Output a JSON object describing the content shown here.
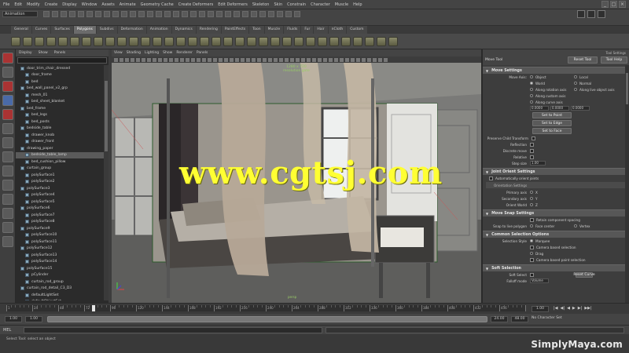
{
  "menubar": {
    "items": [
      "File",
      "Edit",
      "Modify",
      "Create",
      "Display",
      "Window",
      "Assets",
      "Animate",
      "Geometry Cache",
      "Create Deformers",
      "Edit Deformers",
      "Skeleton",
      "Skin",
      "Constrain",
      "Character",
      "Muscle",
      "Help"
    ]
  },
  "statusline": {
    "mode": "Animation"
  },
  "shelf": {
    "tabs": [
      "General",
      "Curves",
      "Surfaces",
      "Polygons",
      "Subdivs",
      "Deformation",
      "Animation",
      "Dynamics",
      "Rendering",
      "PaintEffects",
      "Toon",
      "Muscle",
      "Fluids",
      "Fur",
      "Hair",
      "nCloth",
      "Custom"
    ],
    "active_tab": "Polygons"
  },
  "outliner": {
    "menu": [
      "Display",
      "Show",
      "Panels"
    ],
    "items": [
      {
        "label": "door_trim_chair_dressed",
        "selected": false
      },
      {
        "label": "door_frame",
        "selected": false
      },
      {
        "label": "bed",
        "selected": false
      },
      {
        "label": "bed_wall_panel_v2_grp",
        "selected": false
      },
      {
        "label": "mesh_01",
        "selected": false
      },
      {
        "label": "bed_sheet_blanket",
        "selected": false
      },
      {
        "label": "bed_frame",
        "selected": false
      },
      {
        "label": "bed_legs",
        "selected": false
      },
      {
        "label": "bed_posts",
        "selected": false
      },
      {
        "label": "bedside_table",
        "selected": false
      },
      {
        "label": "drawer_knob",
        "selected": false
      },
      {
        "label": "drawer_front",
        "selected": false
      },
      {
        "label": "drawing_paper",
        "selected": false
      },
      {
        "label": "bedside_table_lamp",
        "selected": true
      },
      {
        "label": "bed_cushion_pillow",
        "selected": false
      },
      {
        "label": "curtain_group",
        "selected": false
      },
      {
        "label": "polySurface1",
        "selected": false
      },
      {
        "label": "polySurface2",
        "selected": false
      },
      {
        "label": "polySurface3",
        "selected": false
      },
      {
        "label": "polySurface4",
        "selected": false
      },
      {
        "label": "polySurface5",
        "selected": false
      },
      {
        "label": "polySurface6",
        "selected": false
      },
      {
        "label": "polySurface7",
        "selected": false
      },
      {
        "label": "polySurface8",
        "selected": false
      },
      {
        "label": "polySurface9",
        "selected": false
      },
      {
        "label": "polySurface10",
        "selected": false
      },
      {
        "label": "polySurface11",
        "selected": false
      },
      {
        "label": "polySurface12",
        "selected": false
      },
      {
        "label": "polySurface13",
        "selected": false
      },
      {
        "label": "polySurface14",
        "selected": false
      },
      {
        "label": "polySurface15",
        "selected": false
      },
      {
        "label": "pCylinder",
        "selected": false
      },
      {
        "label": "curtain_rod_group",
        "selected": false
      },
      {
        "label": "curtain_rod_detail_C3_D3",
        "selected": false
      },
      {
        "label": "defaultLightSet",
        "selected": false
      },
      {
        "label": "defaultObjectSet",
        "selected": false
      }
    ]
  },
  "viewport": {
    "menu": [
      "View",
      "Shading",
      "Lighting",
      "Show",
      "Renderer",
      "Panels"
    ],
    "stats_line1": "1280 x 720",
    "stats_line2": "resolution gate",
    "gate_label": "persp"
  },
  "watermark": {
    "text": "www.cgtsj.com"
  },
  "attr": {
    "caption": "Tool Settings",
    "title": "Move Tool",
    "reset_label": "Reset Tool",
    "help_label": "Tool Help",
    "move_settings": {
      "header": "Move Settings",
      "move_axis_label": "Move Axis:",
      "options": [
        {
          "label": "Object",
          "on": false
        },
        {
          "label": "Local",
          "on": false
        },
        {
          "label": "World",
          "on": true
        },
        {
          "label": "Normal",
          "on": false
        },
        {
          "label": "Along rotation axis",
          "on": false
        },
        {
          "label": "Along live object axis",
          "on": false
        },
        {
          "label": "Along custom axis",
          "on": false
        },
        {
          "label": "Along curve axis",
          "on": false
        }
      ],
      "xyz_values": [
        "0.0000",
        "0.0000",
        "0.0000"
      ],
      "set_to_point": "Set to Point",
      "set_to_edge": "Set to Edge",
      "set_to_face": "Set to Face",
      "preserve_uvs": "Preserve Child Transform",
      "reflection": "Reflection",
      "discrete_move": "Discrete move",
      "relative": "Relative",
      "step_size_label": "Step size",
      "step_size_value": "1.00"
    },
    "joint_orient": {
      "header": "Joint Orient Settings",
      "automatically_label": "Automatically orient joints",
      "sub": "Orientation Settings",
      "primary_axis": "Primary axis",
      "secondary_axis": "Secondary axis",
      "world_orient": "Orient World",
      "axis_x": "X",
      "axis_y": "Y",
      "axis_z": "Z"
    },
    "move_snap": {
      "header": "Move Snap Settings",
      "retain_label": "Retain component spacing",
      "snap_to_poly": "Snap to live polygon",
      "face_center": "Face center",
      "vertex": "Vertex"
    },
    "common_selection": {
      "header": "Common Selection Options",
      "selection_style": "Selection Style",
      "marquee": "Marquee",
      "camera_based": "Camera based selection",
      "drag": "Drag",
      "camera_based_paint": "Camera based paint selection"
    },
    "soft_selection": {
      "header": "Soft Selection",
      "soft_select": "Soft Select",
      "falloff_mode": "Falloff mode",
      "falloff_value": "Volume",
      "reset_curve": "Reset Curve"
    }
  },
  "timeslider": {
    "tick_labels": [
      "1",
      "24",
      "48",
      "72",
      "96",
      "120",
      "144",
      "168",
      "192",
      "216",
      "240",
      "264",
      "288",
      "312",
      "336",
      "360",
      "384",
      "408",
      "432",
      "456"
    ],
    "current_frame": "1.00",
    "play_controls": [
      "|◀",
      "◀|",
      "◀",
      "▶",
      "▶|",
      "▶▶|"
    ]
  },
  "range": {
    "start": "1.00",
    "start2": "1.00",
    "end": "24.00",
    "end2": "48.00",
    "char_set": "No Character Set"
  },
  "cmdline": {
    "label": "MEL"
  },
  "helpline": {
    "text": "Select Tool: select an object"
  },
  "brand": {
    "text": "SimplyMaya.com"
  }
}
